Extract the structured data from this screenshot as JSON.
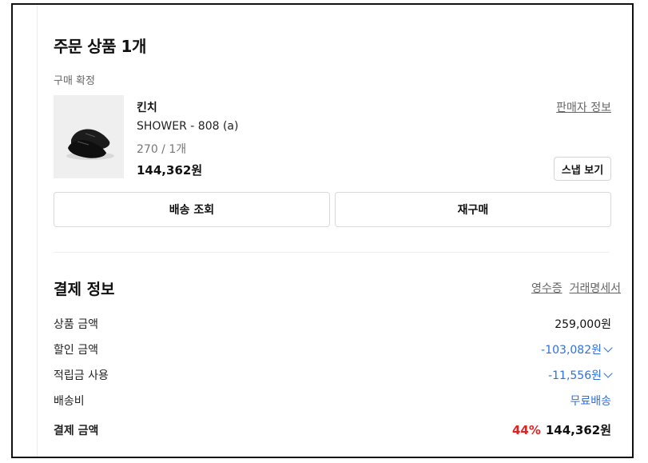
{
  "order": {
    "title": "주문 상품 1개",
    "status": "구매 확정"
  },
  "product": {
    "image_icon": "shoe-image",
    "brand": "킨치",
    "name": "SHOWER - 808 (a)",
    "option": "270 / 1개",
    "price": "144,362원",
    "seller_link": "판매자 정보",
    "snap_button": "스냅 보기"
  },
  "actions": {
    "track": "배송 조회",
    "rebuy": "재구매"
  },
  "payment": {
    "title": "결제 정보",
    "receipt": "영수증",
    "statement": "거래명세서",
    "rows": [
      {
        "label": "상품 금액",
        "value": "259,000원"
      },
      {
        "label": "할인 금액",
        "value": "-103,082원"
      },
      {
        "label": "적립금 사용",
        "value": "-11,556원"
      },
      {
        "label": "배송비",
        "value": "무료배송"
      }
    ],
    "total_label": "결제 금액",
    "total_discount": "44%",
    "total_value": "144,362원"
  },
  "colors": {
    "accent_blue": "#2f6fdf",
    "discount_red": "#e02222"
  }
}
